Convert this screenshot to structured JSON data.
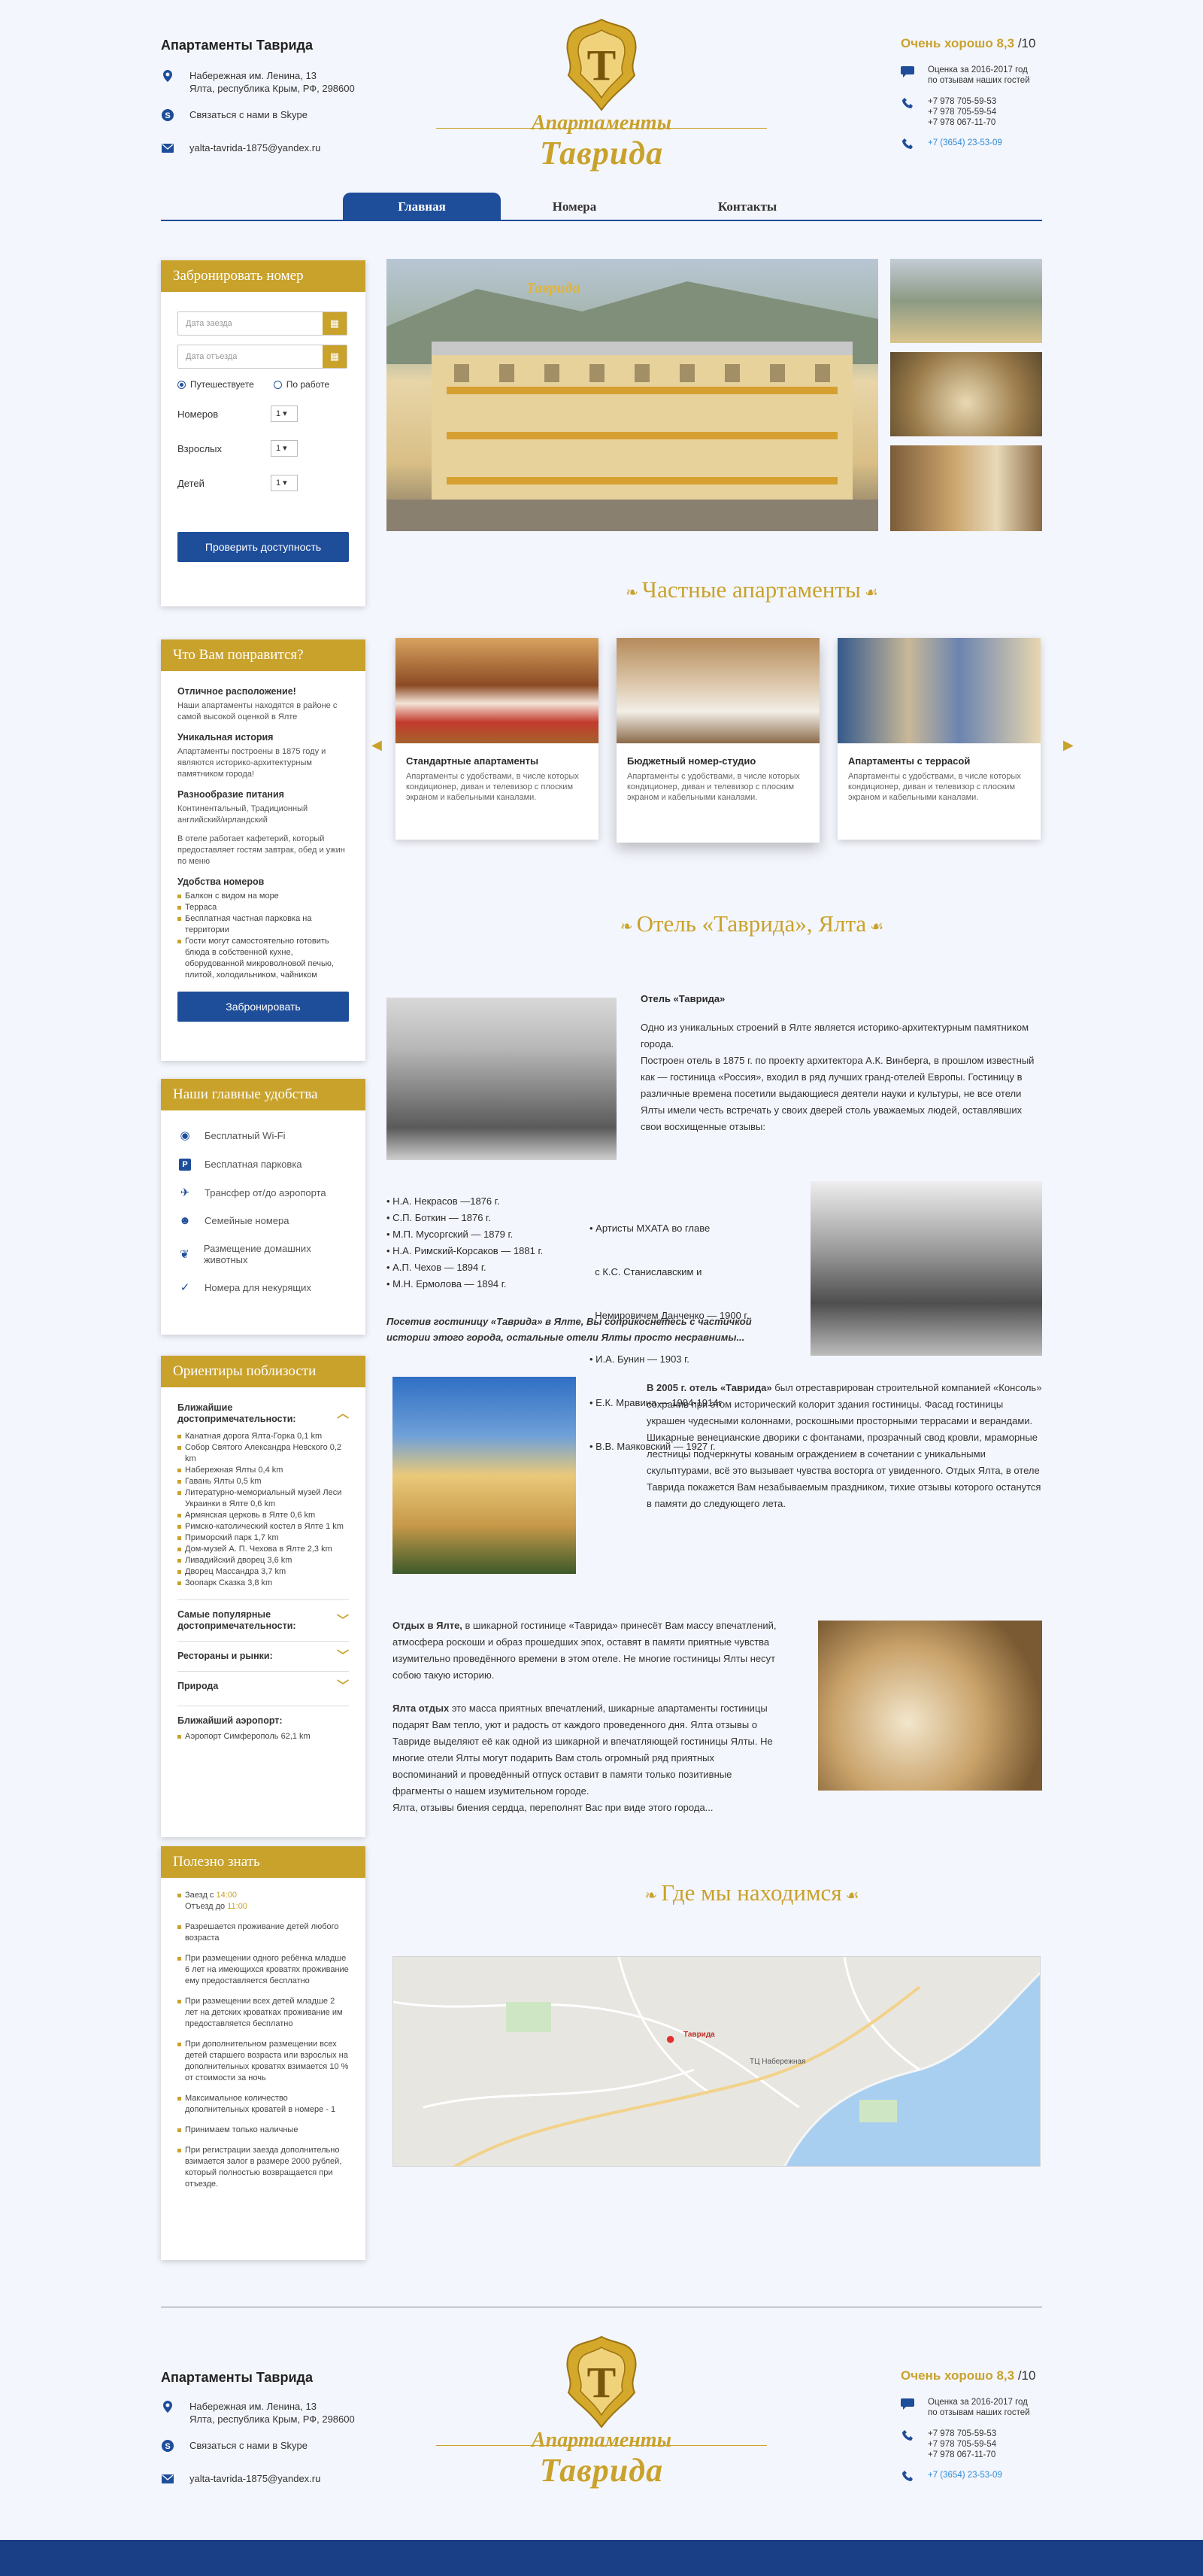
{
  "header": {
    "title": "Апартаменты Таврида",
    "address": "Набережная им. Ленина, 13\nЯлта, республика Крым, РФ, 298600",
    "skype": "Связаться с нами в Skype",
    "email": "yalta-tavrida-1875@yandex.ru",
    "rating_label": "Очень хорошо 8,3",
    "rating_max": "/10",
    "rating_note": "Оценка за 2016-2017 год\nпо отзывам наших гостей",
    "phones": "+7 978 705-59-53\n+7 978 705-59-54\n+7 978 067-11-70",
    "landline": "+7 (3654) 23-53-09",
    "logo_top": "Апартаменты",
    "logo_main": "Таврида",
    "logo_letter": "Т"
  },
  "nav": {
    "items": [
      "Главная",
      "Номера",
      "Контакты"
    ]
  },
  "booking": {
    "title": "Забронировать номер",
    "checkin": "Дата заезда",
    "checkout": "Дата отъезда",
    "travel": "Путешествуете",
    "work": "По работе",
    "rooms": "Номеров",
    "adults": "Взрослых",
    "kids": "Детей",
    "rooms_val": "1",
    "adults_val": "1",
    "kids_val": "1",
    "button": "Проверить доступность"
  },
  "likes": {
    "title": "Что Вам понравится?",
    "h1": "Отличное расположение!",
    "t1": "Наши апартаменты находятся в районе с самой высокой оценкой в Ялте",
    "h2": "Уникальная история",
    "t2": "Апартаменты построены в 1875 году и являются историко-архитектурным памятником города!",
    "h3": "Разнообразие питания",
    "t3": "Континентальный, Традиционный английский/ирландский",
    "t3b": "В отеле работает кафетерий, который предоставляет гостям завтрак, обед и ужин по меню",
    "h4": "Удобства номеров",
    "list": [
      "Балкон с видом на море",
      "Терраса",
      "Бесплатная частная парковка на территории",
      "Гости могут самостоятельно готовить блюда в собственной кухне, оборудованной микроволновой печью, плитой, холодильником, чайником"
    ],
    "button": "Забронировать"
  },
  "amenities": {
    "title": "Наши главные удобства",
    "items": [
      "Бесплатный Wi-Fi",
      "Бесплатная парковка",
      "Трансфер от/до аэропорта",
      "Семейные номера",
      "Размещение домашних животных",
      "Номера для некурящих"
    ]
  },
  "nearby": {
    "title": "Ориентиры поблизости",
    "sec1": "Ближайшие достопримечательности:",
    "list": [
      "Канатная дорога Ялта-Горка 0,1 km",
      "Собор Святого Александра Невского 0,2 km",
      "Набережная Ялты 0,4 km",
      "Гавань Ялты 0,5 km",
      "Литературно-мемориальный музей Леси Украинки в Ялте 0,6 km",
      "Армянская церковь в Ялте 0,6 km",
      "Римско-католический костел в Ялте 1 km",
      "Приморский парк 1,7 km",
      "Дом-музей А. П. Чехова в Ялте 2,3 km",
      "Ливадийский дворец 3,6 km",
      "Дворец Массандра 3,7 km",
      "Зоопарк Сказка 3,8 km"
    ],
    "sec2": "Самые популярные достопримечательности:",
    "sec3": "Рестораны и рынки:",
    "sec4": "Природа",
    "sec5": "Ближайший аэропорт:",
    "airport": "Аэропорт Симферополь 62,1 km"
  },
  "useful": {
    "title": "Полезно знать",
    "checkin": "Заезд с ",
    "checkin_t": "14:00",
    "checkout": "Отъезд до ",
    "checkout_t": "11:00",
    "items": [
      "Разрешается проживание детей любого возраста",
      "При размещении одного ребёнка младше 6 лет на имеющихся кроватях проживание ему предоставляется бесплатно",
      "При размещении всех детей младше 2 лет на детских кроватках проживание им предоставляется бесплатно",
      "При дополнительном размещении всех детей старшего возраста или взрослых на дополнительных кроватях взимается 10 % от стоимости за ночь",
      "Максимальное количество дополнительных кроватей в номере - 1",
      "Принимаем только наличные",
      "При регистрации заезда дополнительно взимается залог в размере 2000 рублей, который полностью возвращается при отъезде."
    ]
  },
  "sections": {
    "apartments": "Частные апартаменты",
    "hotel": "Отель «Таврида», Ялта",
    "location": "Где мы находимся"
  },
  "cards": [
    {
      "title": "Стандартные апартаменты",
      "desc": "Апартаменты с удобствами, в числе которых кондиционер, диван и телевизор с плоским экраном и кабельными каналами."
    },
    {
      "title": "Бюджетный номер-студио",
      "desc": "Апартаменты с удобствами, в числе которых кондиционер, диван и телевизор с плоским экраном и кабельными каналами."
    },
    {
      "title": "Апартаменты с террасой",
      "desc": "Апартаменты с удобствами, в числе которых кондиционер, диван и телевизор с плоским экраном и кабельными каналами."
    }
  ],
  "hotel": {
    "heading": "Отель «Таврида»",
    "p1": "Одно из уникальных строений в Ялте является историко-архитектурным памятником города.\nПостроен отель в 1875 г. по проекту архитектора А.К. Винберга, в прошлом известный как — гостиница «Россия», входил в ряд лучших гранд-отелей Европы. Гостиницу в различные времена посетили выдающиеся деятели науки и культуры, не все отели Ялты имели честь встречать у своих дверей столь уважаемых людей, оставлявших свои восхищенные отзывы:",
    "guests_left": [
      "• Н.А. Некрасов —1876 г.",
      "• С.П. Боткин — 1876 г.",
      "• М.П. Мусоргский — 1879 г.",
      "• Н.А. Римский-Корсаков — 1881 г.",
      "• А.П. Чехов — 1894 г.",
      "• М.Н. Ермолова — 1894 г."
    ],
    "guests_right": [
      "• Артисты МХАТА во главе",
      "  с К.С. Станиславским и",
      "  Немировичем Данченко — 1900 г.",
      "• И.А. Бунин — 1903 г.",
      "• Е.К. Мравина — 1904-1914г",
      "• В.В. Маяковский — 1927 г."
    ],
    "quote": "Посетив гостиницу «Таврида» в Ялте, Вы соприкоснетесь с частичкой истории этого города, остальные отели Ялты просто несравнимы...",
    "p2_bold": "В 2005 г. отель «Таврида»",
    "p2": " был отреставрирован строительной компанией «Консоль» сохранив при этом исторический колорит здания гостиницы. Фасад гостиницы украшен чудесными колоннами, роскошными просторными террасами и верандами. Шикарные венецианские дворики с фонтанами, прозрачный свод кровли, мраморные лестницы подчеркнуты кованым ограждением в сочетании с уникальными скульптурами, всё это вызывает чувства восторга от увиденного. Отдых Ялта, в отеле Таврида покажется Вам незабываемым праздником, тихие отзывы которого останутся в памяти до следующего лета.",
    "p3_bold": "Отдых в Ялте,",
    "p3": " в шикарной гостинице «Таврида» принесёт Вам массу впечатлений, атмосфера роскоши и образ прошедших эпох, оставят в памяти приятные чувства изумительно проведённого времени в этом отеле. Не многие гостиницы Ялты несут собою такую историю.",
    "p4_bold": "Ялта отдых",
    "p4": " это масса приятных впечатлений, шикарные апартаменты гостиницы подарят Вам тепло, уют и радость от каждого проведенного дня. Ялта отзывы о Тавриде выделяют её как одной из шикарной и впечатляющей гостиницы Ялты. Не многие отели Ялты могут подарить Вам столь огромный ряд приятных воспоминаний и проведённый отпуск оставит в памяти только позитивные фрагменты о нашем изумительном городе.\nЯлта, отзывы биения сердца, переполнят Вас при виде этого города..."
  },
  "photo_caption": "Таврида",
  "map": {
    "label": "ТЦ Набережная",
    "pin": "Таврида"
  }
}
